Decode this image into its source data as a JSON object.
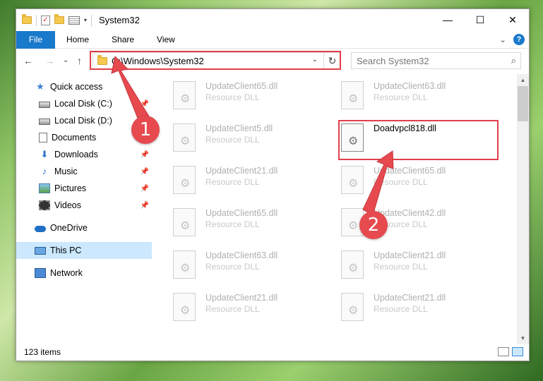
{
  "window": {
    "title": "System32",
    "minimize_glyph": "—",
    "maximize_glyph": "☐",
    "close_glyph": "✕"
  },
  "ribbon": {
    "tabs": [
      "File",
      "Home",
      "Share",
      "View"
    ],
    "expand_glyph": "⌄",
    "help_glyph": "?"
  },
  "nav": {
    "back": "←",
    "forward": "→",
    "recent": "⌄",
    "up": "↑",
    "address": "C:\\Windows\\System32",
    "address_dropdown": "⌄",
    "refresh": "↻",
    "search_placeholder": "Search System32",
    "search_glyph": "⌕"
  },
  "sidebar": {
    "items": [
      {
        "label": "Quick access",
        "icon": "star-icon",
        "glyph": "★",
        "pinned": false,
        "selected": false
      },
      {
        "label": "Local Disk (C:)",
        "icon": "drive-icon",
        "glyph": "",
        "pinned": true,
        "selected": false
      },
      {
        "label": "Local Disk (D:)",
        "icon": "drive-icon",
        "glyph": "",
        "pinned": false,
        "selected": false
      },
      {
        "label": "Documents",
        "icon": "documents-icon",
        "glyph": "",
        "pinned": true,
        "selected": false
      },
      {
        "label": "Downloads",
        "icon": "download-icon",
        "glyph": "⬇",
        "pinned": true,
        "selected": false
      },
      {
        "label": "Music",
        "icon": "music-icon",
        "glyph": "♪",
        "pinned": true,
        "selected": false
      },
      {
        "label": "Pictures",
        "icon": "pictures-icon",
        "glyph": "",
        "pinned": true,
        "selected": false
      },
      {
        "label": "Videos",
        "icon": "videos-icon",
        "glyph": "",
        "pinned": true,
        "selected": false
      },
      {
        "label": "OneDrive",
        "icon": "onedrive-icon",
        "glyph": "",
        "pinned": false,
        "selected": false
      },
      {
        "label": "This PC",
        "icon": "computer-icon",
        "glyph": "",
        "pinned": false,
        "selected": true
      },
      {
        "label": "Network",
        "icon": "network-icon",
        "glyph": "",
        "pinned": false,
        "selected": false
      }
    ],
    "pin_glyph": "📌"
  },
  "files": {
    "items": [
      {
        "name": "UpdateClient65.dll",
        "type": "Resource DLL",
        "highlighted": false
      },
      {
        "name": "UpdateClient63.dll",
        "type": "Resource DLL",
        "highlighted": false
      },
      {
        "name": "UpdateClient5.dll",
        "type": "Resource DLL",
        "highlighted": false
      },
      {
        "name": "Doadvpcl818.dll",
        "type": "",
        "highlighted": true
      },
      {
        "name": "UpdateClient21.dll",
        "type": "Resource DLL",
        "highlighted": false
      },
      {
        "name": "UpdateClient65.dll",
        "type": "Resource DLL",
        "highlighted": false
      },
      {
        "name": "UpdateClient65.dll",
        "type": "Resource DLL",
        "highlighted": false
      },
      {
        "name": "UpdateClient42.dll",
        "type": "Resource DLL",
        "highlighted": false
      },
      {
        "name": "UpdateClient63.dll",
        "type": "Resource DLL",
        "highlighted": false
      },
      {
        "name": "UpdateClient21.dll",
        "type": "Resource DLL",
        "highlighted": false
      },
      {
        "name": "UpdateClient21.dll",
        "type": "Resource DLL",
        "highlighted": false
      },
      {
        "name": "UpdateClient21.dll",
        "type": "Resource DLL",
        "highlighted": false
      }
    ]
  },
  "scrollbar": {
    "up": "▲",
    "down": "▼"
  },
  "status": {
    "item_count": "123 items"
  },
  "annotations": {
    "callout_1": "1",
    "callout_2": "2",
    "accent_color": "#e64a4f"
  }
}
